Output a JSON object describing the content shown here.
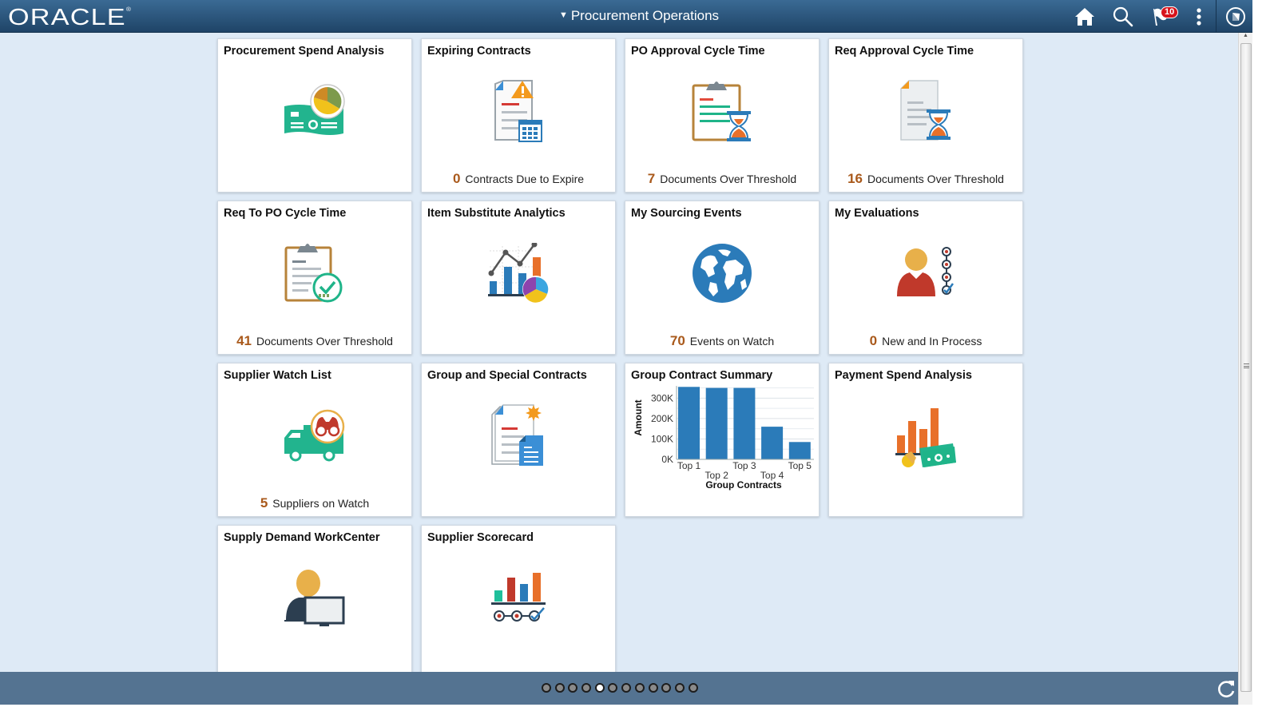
{
  "header": {
    "logo": "ORACLE",
    "title": "Procurement Operations",
    "notification_count": "10",
    "icons": [
      "home-icon",
      "search-icon",
      "notifications-flag-icon",
      "actions-menu-icon",
      "navbar-compass-icon"
    ]
  },
  "tiles": [
    {
      "title": "Procurement Spend Analysis",
      "icon": "spend-analysis-icon"
    },
    {
      "title": "Expiring Contracts",
      "icon": "expiring-contract-icon",
      "count": "0",
      "label": "Contracts Due to Expire"
    },
    {
      "title": "PO Approval Cycle Time",
      "icon": "clipboard-hourglass-icon",
      "count": "7",
      "label": "Documents Over Threshold"
    },
    {
      "title": "Req Approval Cycle Time",
      "icon": "document-hourglass-icon",
      "count": "16",
      "label": "Documents Over Threshold"
    },
    {
      "title": "Req To PO Cycle Time",
      "icon": "clipboard-check-icon",
      "count": "41",
      "label": "Documents Over Threshold"
    },
    {
      "title": "Item Substitute Analytics",
      "icon": "analytics-chart-icon"
    },
    {
      "title": "My Sourcing Events",
      "icon": "globe-icon",
      "count": "70",
      "label": "Events on Watch"
    },
    {
      "title": "My Evaluations",
      "icon": "evaluation-person-icon",
      "count": "0",
      "label": "New and In Process"
    },
    {
      "title": "Supplier Watch List",
      "icon": "truck-binoculars-icon",
      "count": "5",
      "label": "Suppliers on Watch"
    },
    {
      "title": "Group and Special Contracts",
      "icon": "contract-documents-icon"
    },
    {
      "title": "Group Contract Summary",
      "icon": "bar-chart"
    },
    {
      "title": "Payment Spend Analysis",
      "icon": "payment-chart-icon"
    },
    {
      "title": "Supply Demand WorkCenter",
      "icon": "person-monitor-icon"
    },
    {
      "title": "Supplier Scorecard",
      "icon": "scorecard-icon"
    }
  ],
  "chart_data": {
    "type": "bar",
    "title": "Group Contract Summary",
    "categories": [
      "Top 1",
      "Top 2",
      "Top 3",
      "Top 4",
      "Top 5"
    ],
    "values": [
      355000,
      350000,
      350000,
      160000,
      85000
    ],
    "xlabel": "Group Contracts",
    "ylabel": "Amount",
    "yticks": [
      "0K",
      "100K",
      "200K",
      "300K"
    ],
    "ylim": [
      0,
      360000
    ],
    "grid": true,
    "color": "#2b7bb9"
  },
  "footer": {
    "page_count": 12,
    "active_page": 5,
    "refresh_icon": "refresh-icon"
  },
  "colors": {
    "header": "#2c5882",
    "metric_number": "#a9591b",
    "background": "#deeaf6"
  }
}
